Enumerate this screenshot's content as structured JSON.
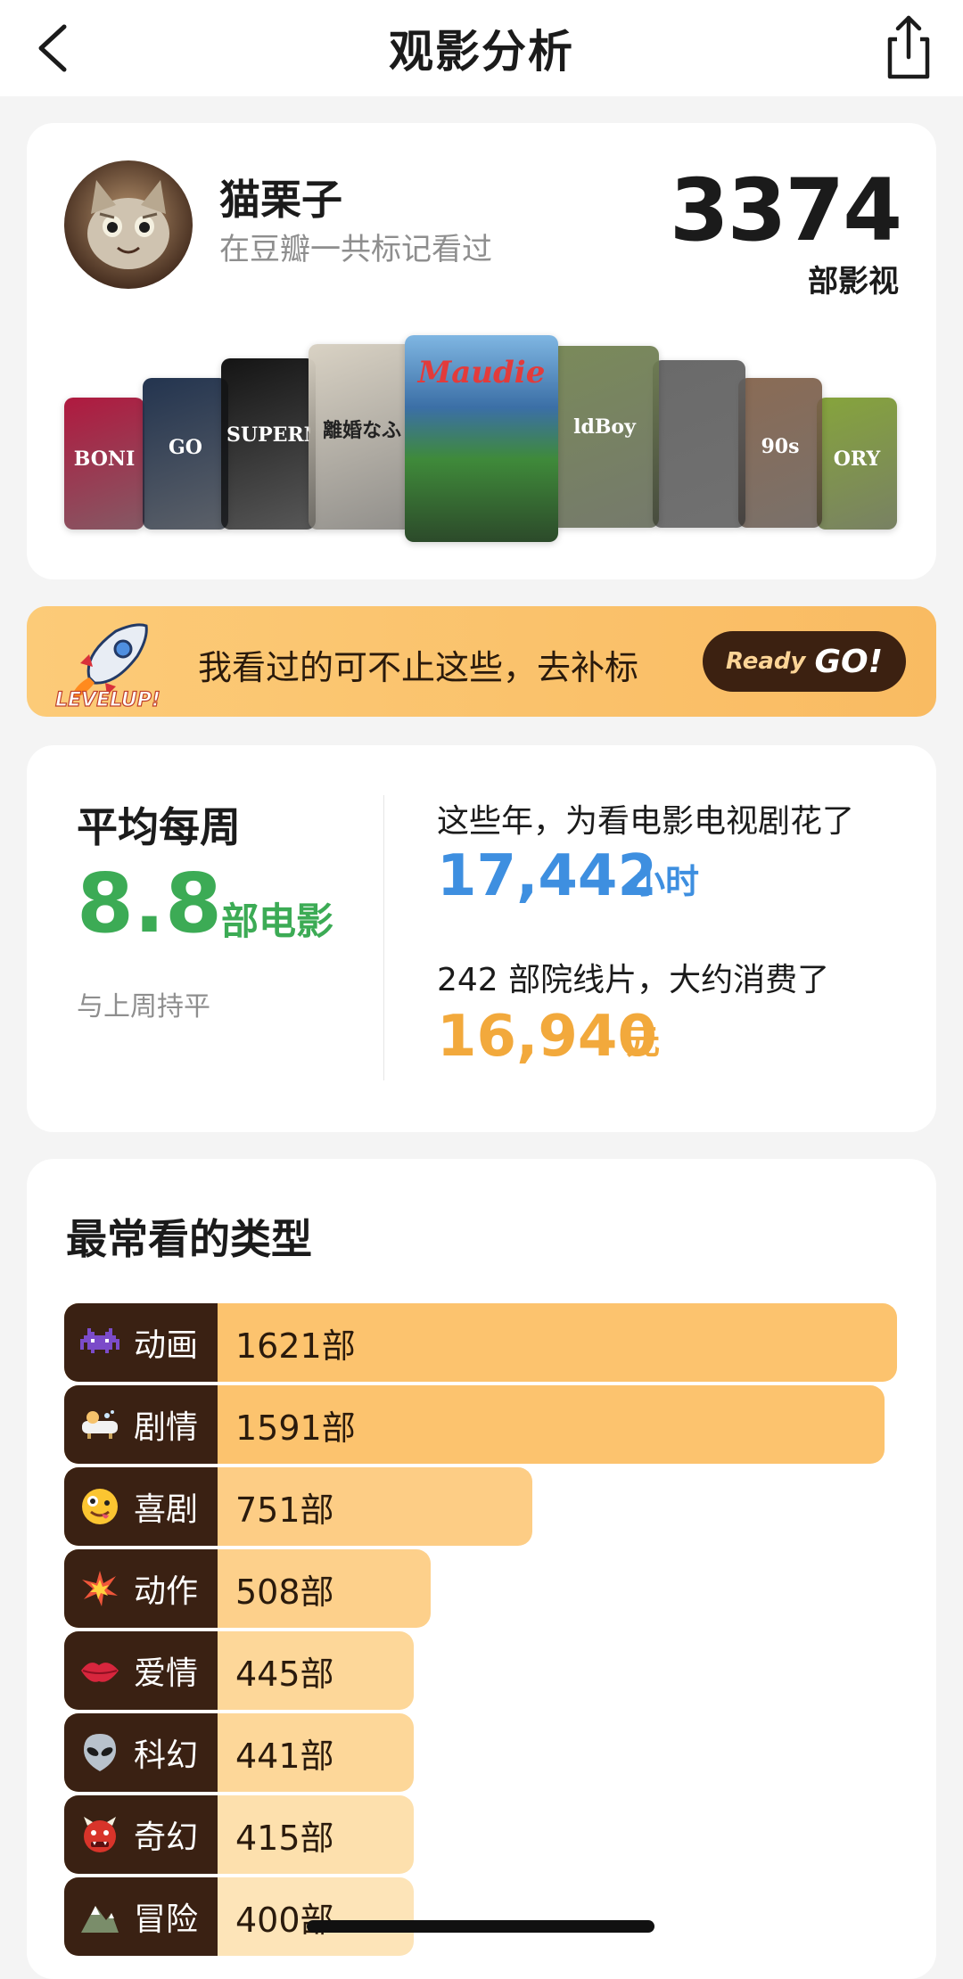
{
  "nav": {
    "title": "观影分析"
  },
  "profile": {
    "username": "猫栗子",
    "subtitle": "在豆瓣一共标记看过",
    "total_count": "3374",
    "total_unit": "部影视",
    "posters": [
      {
        "text": "BONI",
        "color": "#b0193f"
      },
      {
        "text": "GO",
        "color": "#23344f"
      },
      {
        "text": "SUPERNAT",
        "color": "#141414"
      },
      {
        "text": "離婚なふ",
        "color": "#d9d2c4"
      },
      {
        "text": "Maudie",
        "color": "#3b6fa6"
      },
      {
        "text": "ldBoy",
        "color": "#7a8a5a"
      },
      {
        "text": "",
        "color": "#6a6a6a"
      },
      {
        "text": "90s",
        "color": "#8a6b55"
      },
      {
        "text": "ORY",
        "color": "#86a43c"
      }
    ]
  },
  "banner": {
    "badge": "LEVELUP!",
    "text": "我看过的可不止这些，去补标",
    "button_small": "Ready",
    "button_big": "GO!"
  },
  "stats": {
    "weekly_label": "平均每周",
    "weekly_value": "8.8",
    "weekly_unit": "部电影",
    "weekly_compare": "与上周持平",
    "hours_label": "这些年，为看电影电视剧花了",
    "hours_value": "17,442",
    "hours_unit": "小时",
    "cinema_label": "242 部院线片，大约消费了",
    "money_value": "16,940",
    "money_unit": "元",
    "colors": {
      "weekly": "#3cab55",
      "hours": "#3e8fe0",
      "money": "#f2a93c"
    }
  },
  "genres": {
    "title": "最常看的类型",
    "items": [
      {
        "icon": "space-invader-icon",
        "name": "动画",
        "count": "1621部",
        "value": 1621
      },
      {
        "icon": "bathtub-icon",
        "name": "剧情",
        "count": "1591部",
        "value": 1591
      },
      {
        "icon": "zany-face-icon",
        "name": "喜剧",
        "count": "751部",
        "value": 751
      },
      {
        "icon": "explosion-icon",
        "name": "动作",
        "count": "508部",
        "value": 508
      },
      {
        "icon": "kiss-lips-icon",
        "name": "爱情",
        "count": "445部",
        "value": 445
      },
      {
        "icon": "alien-icon",
        "name": "科幻",
        "count": "441部",
        "value": 441
      },
      {
        "icon": "ogre-icon",
        "name": "奇幻",
        "count": "415部",
        "value": 415
      },
      {
        "icon": "mountain-icon",
        "name": "冒险",
        "count": "400部",
        "value": 400
      }
    ]
  }
}
